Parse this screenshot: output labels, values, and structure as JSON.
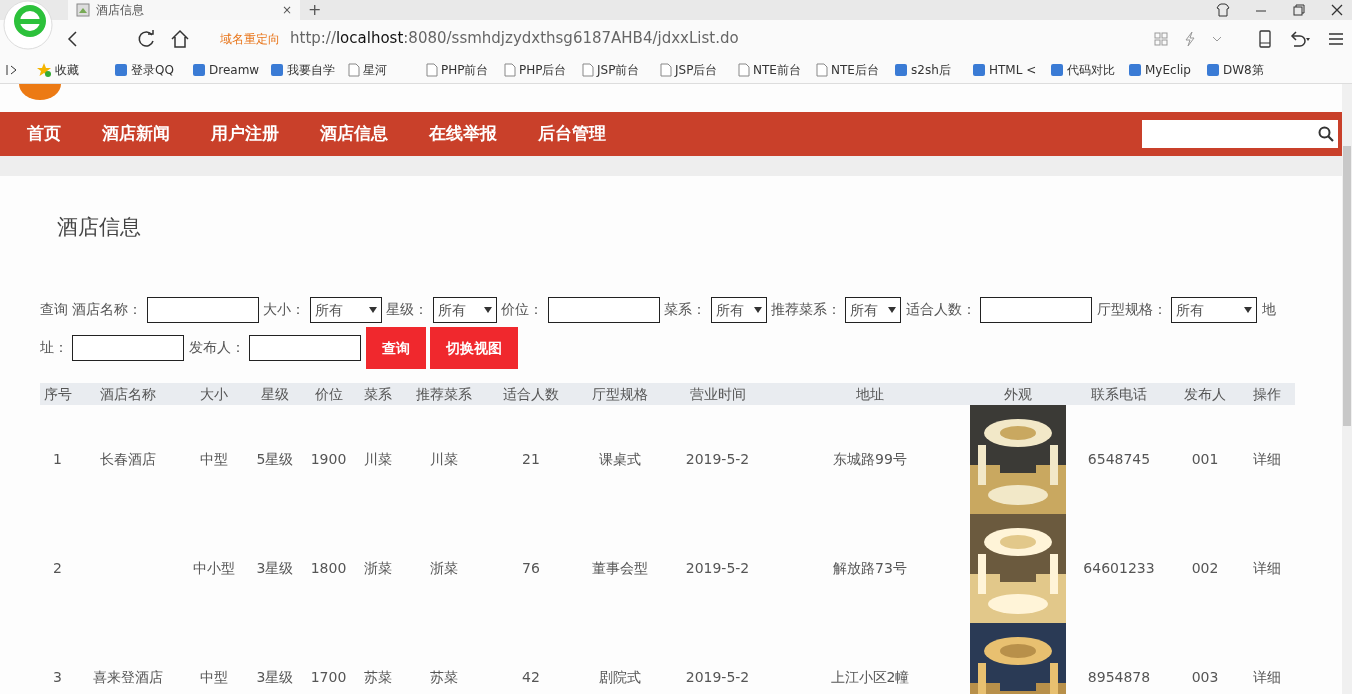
{
  "browser": {
    "tab_title": "酒店信息",
    "tab_close": "×",
    "new_tab": "+",
    "redirect_label": "域名重定向",
    "url_prefix": "http://",
    "url_host": "localhost",
    "url_rest": ":8080/ssmhdjzydxthsg6187AHB4/jdxxList.do",
    "bookmarks": [
      {
        "kind": "star",
        "label": "收藏"
      },
      {
        "kind": "site",
        "label": "登录QQ"
      },
      {
        "kind": "site",
        "label": "Dreamw"
      },
      {
        "kind": "site",
        "label": "我要自学"
      },
      {
        "kind": "page",
        "label": "星河"
      },
      {
        "kind": "page",
        "label": "PHP前台"
      },
      {
        "kind": "page",
        "label": "PHP后台"
      },
      {
        "kind": "page",
        "label": "JSP前台"
      },
      {
        "kind": "page",
        "label": "JSP后台"
      },
      {
        "kind": "page",
        "label": "NTE前台"
      },
      {
        "kind": "page",
        "label": "NTE后台"
      },
      {
        "kind": "site",
        "label": "s2sh后"
      },
      {
        "kind": "site",
        "label": "HTML <"
      },
      {
        "kind": "site",
        "label": "代码对比"
      },
      {
        "kind": "site",
        "label": "MyEclip"
      },
      {
        "kind": "site",
        "label": "DW8第"
      }
    ]
  },
  "nav": [
    "首页",
    "酒店新闻",
    "用户注册",
    "酒店信息",
    "在线举报",
    "后台管理"
  ],
  "page_title": "酒店信息",
  "filters": [
    {
      "kind": "text",
      "text": "查询"
    },
    {
      "kind": "field",
      "label": "酒店名称："
    },
    {
      "kind": "select",
      "label": "大小：",
      "value": "所有"
    },
    {
      "kind": "select",
      "label": "星级：",
      "value": "所有"
    },
    {
      "kind": "field",
      "label": "价位："
    },
    {
      "kind": "select",
      "label": "菜系：",
      "value": "所有"
    },
    {
      "kind": "select",
      "label": "推荐菜系：",
      "value": "所有"
    },
    {
      "kind": "field",
      "label": "适合人数："
    },
    {
      "kind": "select",
      "label": "厅型规格：",
      "value": "所有"
    },
    {
      "kind": "field",
      "label_lines": [
        "地",
        "址："
      ]
    },
    {
      "kind": "field",
      "label": "发布人："
    },
    {
      "kind": "button",
      "text": "查询"
    },
    {
      "kind": "button",
      "text": "切换视图"
    }
  ],
  "table": {
    "columns": [
      "序号",
      "酒店名称",
      "大小",
      "星级",
      "价位",
      "菜系",
      "推荐菜系",
      "适合人数",
      "厅型规格",
      "营业时间",
      "地址",
      "外观",
      "联系电话",
      "发布人",
      "操作"
    ],
    "rows": [
      {
        "cells": [
          "1",
          "长春酒店",
          "中型",
          "5星级",
          "1900",
          "川菜",
          "川菜",
          "21",
          "课桌式",
          "2019-5-2",
          "东城路99号",
          null,
          "6548745",
          "001",
          "详细"
        ]
      },
      {
        "cells": [
          "2",
          null,
          "中小型",
          "3星级",
          "1800",
          "浙菜",
          "浙菜",
          "76",
          "董事会型",
          "2019-5-2",
          "解放路73号",
          null,
          "64601233",
          "002",
          "详细"
        ]
      },
      {
        "cells": [
          "3",
          "喜来登酒店",
          "中型",
          "3星级",
          "1700",
          "苏菜",
          "苏菜",
          "42",
          "剧院式",
          "2019-5-2",
          "上江小区2幢",
          null,
          "8954878",
          "003",
          "详细"
        ]
      }
    ]
  }
}
